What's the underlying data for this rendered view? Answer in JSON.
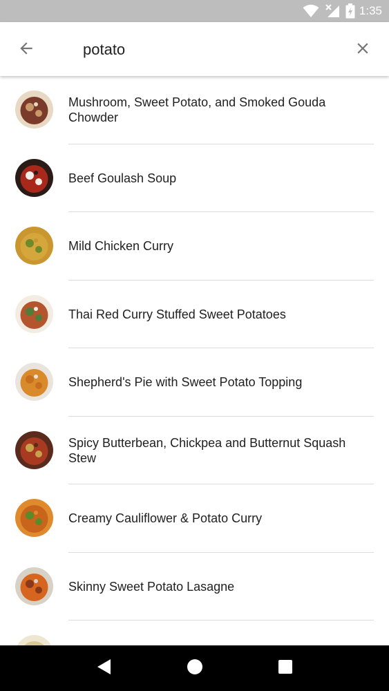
{
  "status_bar": {
    "time": "1:35",
    "icons": [
      "wifi-icon",
      "cell-signal-off-icon",
      "battery-charging-icon"
    ]
  },
  "search": {
    "query": "potato",
    "back_icon": "arrow-back-icon",
    "clear_icon": "close-icon"
  },
  "results": [
    {
      "title": "Mushroom, Sweet Potato, and Smoked Gouda Chowder",
      "thumb_colors": [
        "#e8d9c4",
        "#7a3b2a",
        "#c89a6a"
      ]
    },
    {
      "title": "Beef Goulash Soup",
      "thumb_colors": [
        "#2b1b16",
        "#a8281c",
        "#f2efe6"
      ]
    },
    {
      "title": "Mild Chicken Curry",
      "thumb_colors": [
        "#c9962f",
        "#d4a63c",
        "#6e8a2a"
      ]
    },
    {
      "title": "Thai Red Curry Stuffed Sweet Potatoes",
      "thumb_colors": [
        "#f3ece2",
        "#b4552d",
        "#4f7d3a"
      ]
    },
    {
      "title": "Shepherd's Pie with Sweet Potato Topping",
      "thumb_colors": [
        "#e9e4de",
        "#d98a2b",
        "#c76f1d"
      ]
    },
    {
      "title": "Spicy Butterbean, Chickpea and Butternut Squash Stew",
      "thumb_colors": [
        "#5a2a1c",
        "#a93a22",
        "#c7a24a"
      ]
    },
    {
      "title": "Creamy Cauliflower & Potato Curry",
      "thumb_colors": [
        "#e08a2e",
        "#c8641c",
        "#5a8a2a"
      ]
    },
    {
      "title": "Skinny Sweet Potato Lasagne",
      "thumb_colors": [
        "#d8d2c6",
        "#d6651f",
        "#8a3a1a"
      ]
    },
    {
      "title": "",
      "thumb_colors": [
        "#efe6d2",
        "#d9c79a",
        "#b89a5a"
      ]
    }
  ],
  "nav_bar": {
    "icons": [
      "nav-back-icon",
      "nav-home-icon",
      "nav-recents-icon"
    ]
  }
}
